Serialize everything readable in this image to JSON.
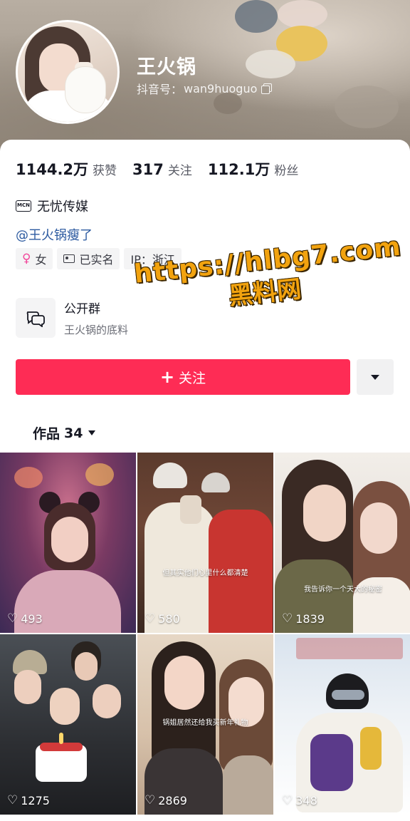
{
  "profile": {
    "name": "王火锅",
    "douyin_id_label": "抖音号：",
    "douyin_id": "wan9huoguo"
  },
  "stats": [
    {
      "value": "1144.2万",
      "label": "获赞"
    },
    {
      "value": "317",
      "label": "关注"
    },
    {
      "value": "112.1万",
      "label": "粉丝"
    }
  ],
  "mcn": {
    "icon_text": "MCN",
    "name": "无忧传媒"
  },
  "bio_link": "@王火锅瘦了",
  "tags": {
    "gender": "女",
    "verified": "已实名",
    "ip": "IP：浙江"
  },
  "group": {
    "title": "公开群",
    "subtitle": "王火锅的底料"
  },
  "watermark": {
    "url": "https://hlbg7.com",
    "name": "黑料网"
  },
  "follow_button": {
    "label": "关注"
  },
  "works_tab": {
    "label": "作品",
    "count": "34"
  },
  "videos": [
    {
      "likes": "493",
      "caption": ""
    },
    {
      "likes": "580",
      "caption": "但其实他们心里什么都清楚"
    },
    {
      "likes": "1839",
      "caption": "我告诉你一个天大的秘密"
    },
    {
      "likes": "1275",
      "caption": ""
    },
    {
      "likes": "2869",
      "caption": "锅姐居然还给我买新年礼物"
    },
    {
      "likes": "348",
      "caption": ""
    }
  ],
  "colors": {
    "accent": "#fe2c55",
    "link": "#2c5aa0",
    "watermark": "#f2a30f"
  }
}
